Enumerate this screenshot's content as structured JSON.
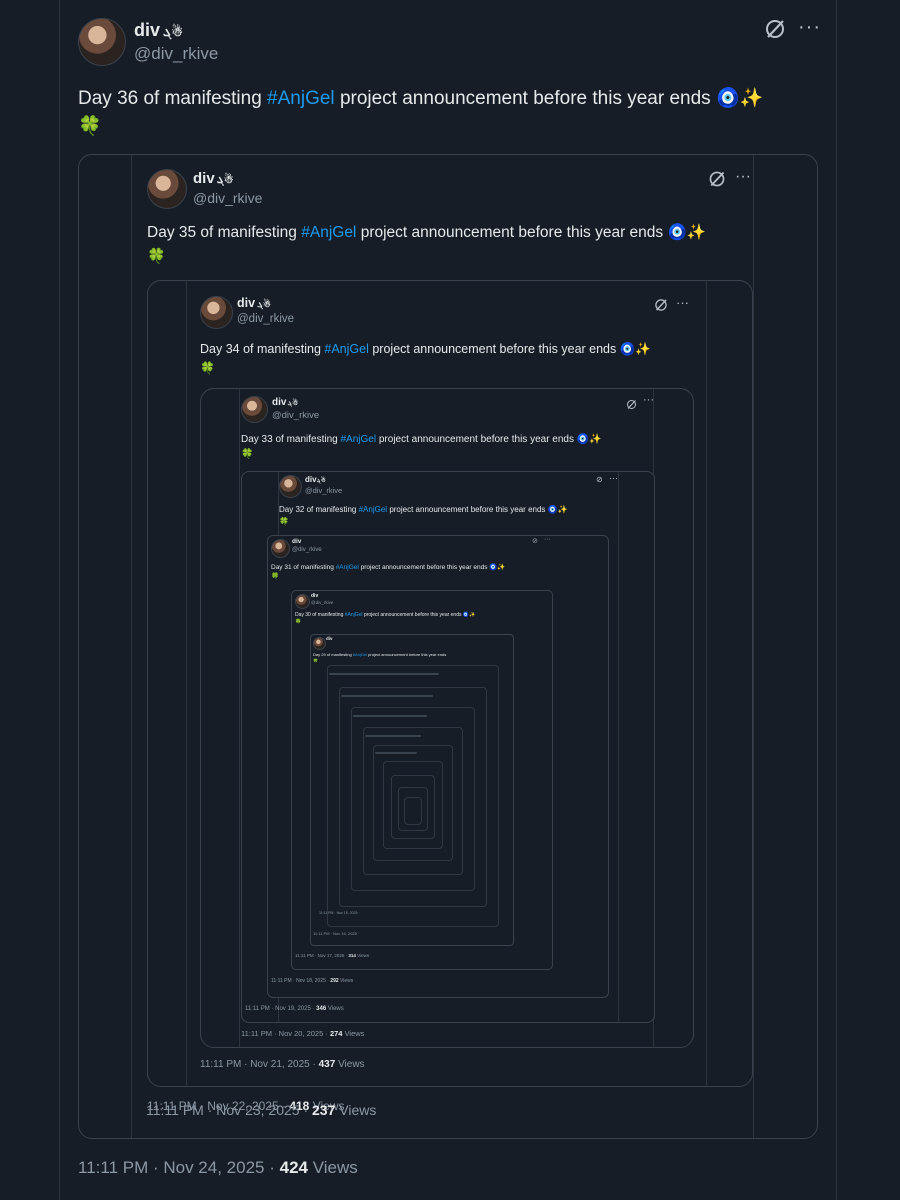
{
  "author": {
    "name": "div",
    "name_glyph": "ܓ☃",
    "handle": "@div_rkive"
  },
  "icons": {
    "grok": "grok-icon",
    "more": "more-icon"
  },
  "hashtag": "#AnjGel",
  "emoji": {
    "nazar": "🧿",
    "sparkles": "✨",
    "clover": "🍀"
  },
  "tweets": [
    {
      "pre": "Day 36 of manifesting",
      "post": "project announcement before this year ends",
      "time": "11:11 PM · Nov 24, 2025 ·",
      "views": "424",
      "views_label": "Views"
    },
    {
      "pre": "Day 35 of manifesting",
      "post": "project announcement before this year ends",
      "time": "11:11 PM · Nov 23, 2025 ·",
      "views": "237",
      "views_label": "Views"
    },
    {
      "pre": "Day 34 of manifesting",
      "post": "project announcement before this year ends",
      "time": "11:11 PM · Nov 22, 2025 ·",
      "views": "418",
      "views_label": "Views"
    },
    {
      "pre": "Day 33 of manifesting",
      "post": "project announcement before this year ends",
      "time": "11:11 PM · Nov 21, 2025 ·",
      "views": "437",
      "views_label": "Views"
    },
    {
      "pre": "Day 32 of manifesting",
      "post": "project announcement before this year ends",
      "time": "11:11 PM · Nov 20, 2025 ·",
      "views": "274",
      "views_label": "Views"
    },
    {
      "pre": "Day 31 of manifesting",
      "post": "project announcement before this year ends",
      "time": "11:11 PM · Nov 19, 2025 ·",
      "views": "346",
      "views_label": "Views"
    },
    {
      "pre": "Day 30 of manifesting",
      "post": "project announcement before this year ends",
      "time": "11:11 PM · Nov 18, 2025 ·",
      "views": "292",
      "views_label": "Views"
    },
    {
      "pre": "Day 29 of manifesting",
      "post": "project announcement before this year ends",
      "time": "11:11 PM · Nov 17, 2025 ·",
      "views": "314",
      "views_label": "Views"
    }
  ],
  "deep_times": [
    "11:11 PM · Nov 16, 2025 ·",
    "11:11 PM · Nov 15, 2025 ·"
  ]
}
